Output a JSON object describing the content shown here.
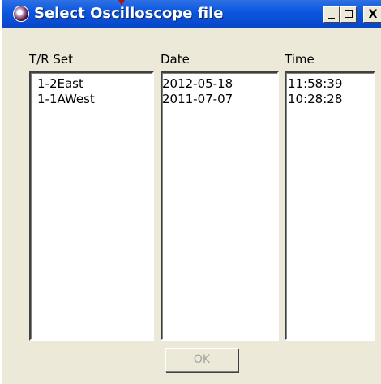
{
  "window": {
    "title": "Select Oscilloscope file",
    "controls": {
      "minimize": "minimize-icon",
      "maximize": "maximize-icon",
      "close_label": "X"
    }
  },
  "columns": [
    {
      "header": "T/R Set",
      "items": [
        "1-2East",
        "1-1AWest"
      ]
    },
    {
      "header": "Date",
      "items": [
        "2012-05-18",
        "2011-07-07"
      ]
    },
    {
      "header": "Time",
      "items": [
        "11:58:39",
        "10:28:28"
      ]
    }
  ],
  "ok_button": {
    "label": "OK",
    "enabled": false
  },
  "colors": {
    "titlebar": "#0b58e0",
    "dialog_bg": "#ece9d8",
    "list_bg": "#ffffff"
  }
}
